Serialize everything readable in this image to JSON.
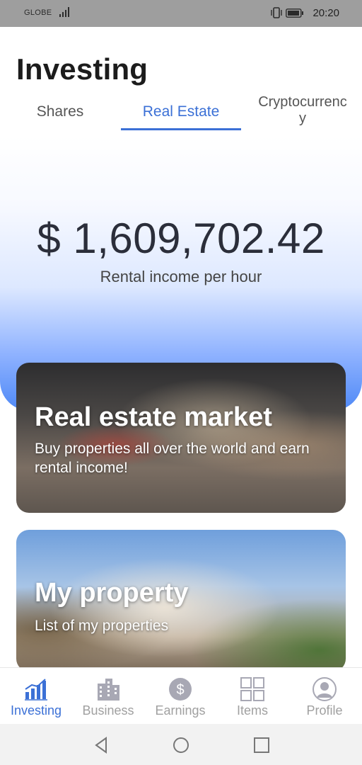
{
  "status_bar": {
    "carrier": "GLOBE",
    "time": "20:20"
  },
  "header": {
    "title": "Investing"
  },
  "tabs": [
    {
      "label": "Shares",
      "active": false
    },
    {
      "label": "Real Estate",
      "active": true
    },
    {
      "label": "Cryptocurrency",
      "active": false
    }
  ],
  "hero": {
    "amount": "$ 1,609,702.42",
    "caption": "Rental income per hour"
  },
  "cards": [
    {
      "title": "Real estate market",
      "subtitle": "Buy properties all over the world and earn rental income!"
    },
    {
      "title": "My property",
      "subtitle": "List of my properties"
    }
  ],
  "bottom_nav": [
    {
      "label": "Investing",
      "icon": "bar-chart-icon",
      "active": true
    },
    {
      "label": "Business",
      "icon": "building-icon",
      "active": false
    },
    {
      "label": "Earnings",
      "icon": "dollar-coin-icon",
      "active": false
    },
    {
      "label": "Items",
      "icon": "grid-icon",
      "active": false
    },
    {
      "label": "Profile",
      "icon": "user-avatar-icon",
      "active": false
    }
  ],
  "colors": {
    "accent": "#3b70d6",
    "inactive": "#a0a0a0",
    "status_bar": "#9e9e9e"
  }
}
